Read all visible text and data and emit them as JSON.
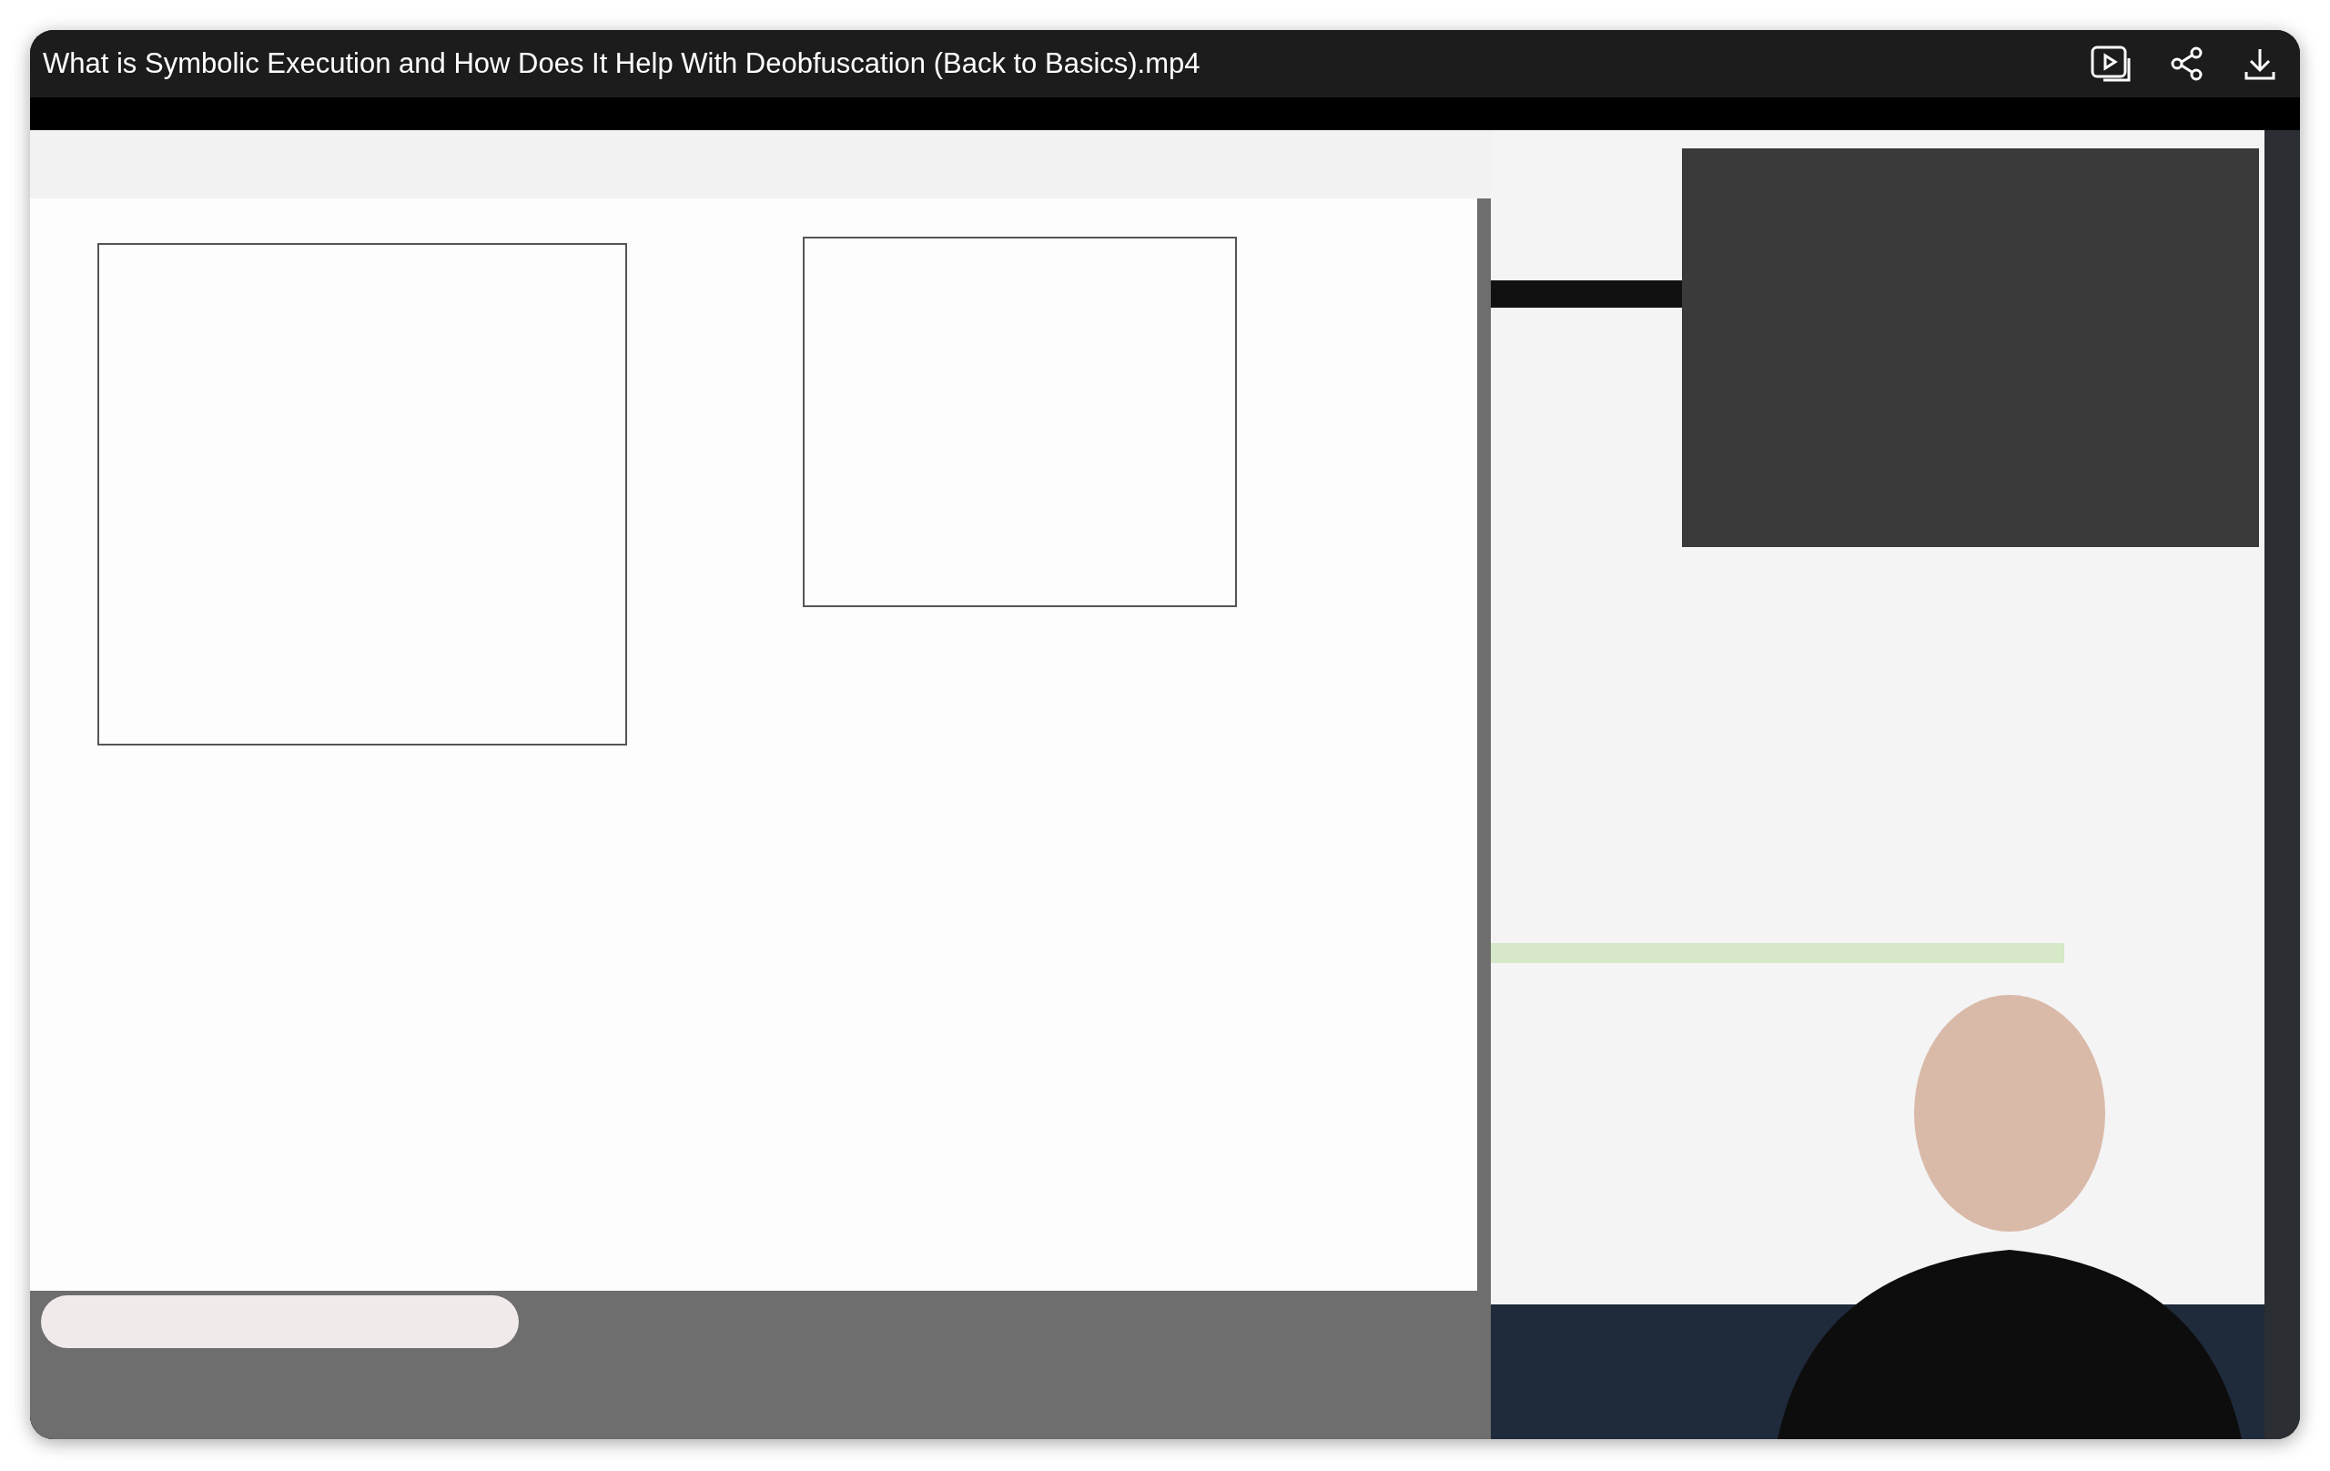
{
  "player": {
    "title": "What is Symbolic Execution and How Does It Help With Deobfuscation (Back to Basics).mp4"
  }
}
